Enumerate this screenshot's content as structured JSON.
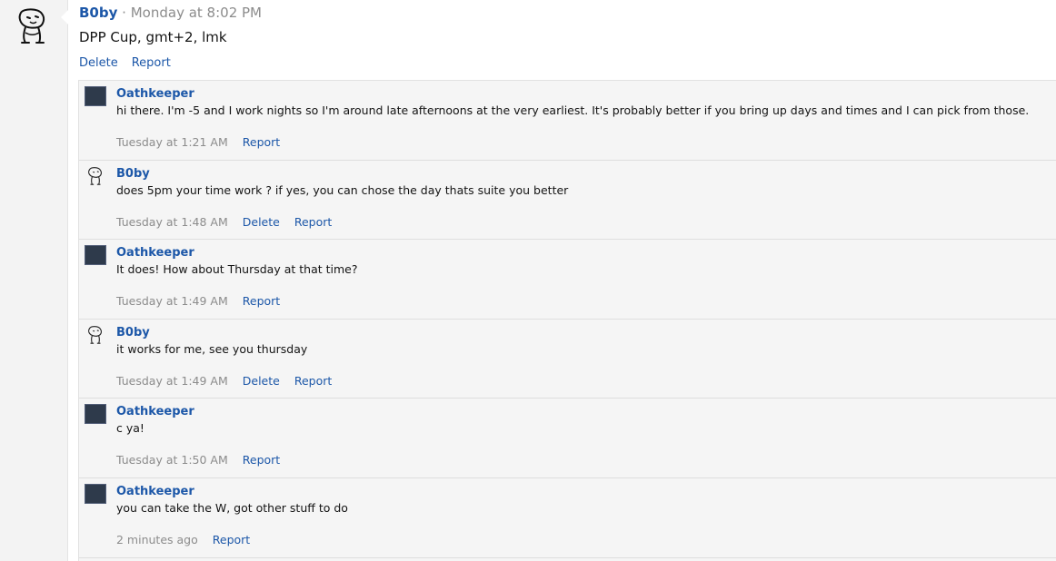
{
  "post": {
    "author": "B0by",
    "separator": "·",
    "time": "Monday at 8:02 PM",
    "body": "DPP Cup, gmt+2, lmk",
    "actions": {
      "delete": "Delete",
      "report": "Report"
    }
  },
  "comments": [
    {
      "author": "Oathkeeper",
      "avatar": "dark-square-avatar",
      "text": "hi there. I'm -5 and I work nights so I'm around late afternoons at the very earliest. It's probably better if you bring up days and times and I can pick from those.",
      "time": "Tuesday at 1:21 AM",
      "report": "Report"
    },
    {
      "author": "B0by",
      "avatar": "doodle-avatar",
      "text": "does 5pm your time work ? if yes, you can chose the day thats suite you better",
      "time": "Tuesday at 1:48 AM",
      "delete": "Delete",
      "report": "Report"
    },
    {
      "author": "Oathkeeper",
      "avatar": "dark-square-avatar",
      "text": "It does! How about Thursday at that time?",
      "time": "Tuesday at 1:49 AM",
      "report": "Report"
    },
    {
      "author": "B0by",
      "avatar": "doodle-avatar",
      "text": "it works for me, see you thursday",
      "time": "Tuesday at 1:49 AM",
      "delete": "Delete",
      "report": "Report"
    },
    {
      "author": "Oathkeeper",
      "avatar": "dark-square-avatar",
      "text": "c ya!",
      "time": "Tuesday at 1:50 AM",
      "report": "Report"
    },
    {
      "author": "Oathkeeper",
      "avatar": "dark-square-avatar",
      "text": "you can take the W, got other stuff to do",
      "time": "2 minutes ago",
      "report": "Report"
    }
  ]
}
